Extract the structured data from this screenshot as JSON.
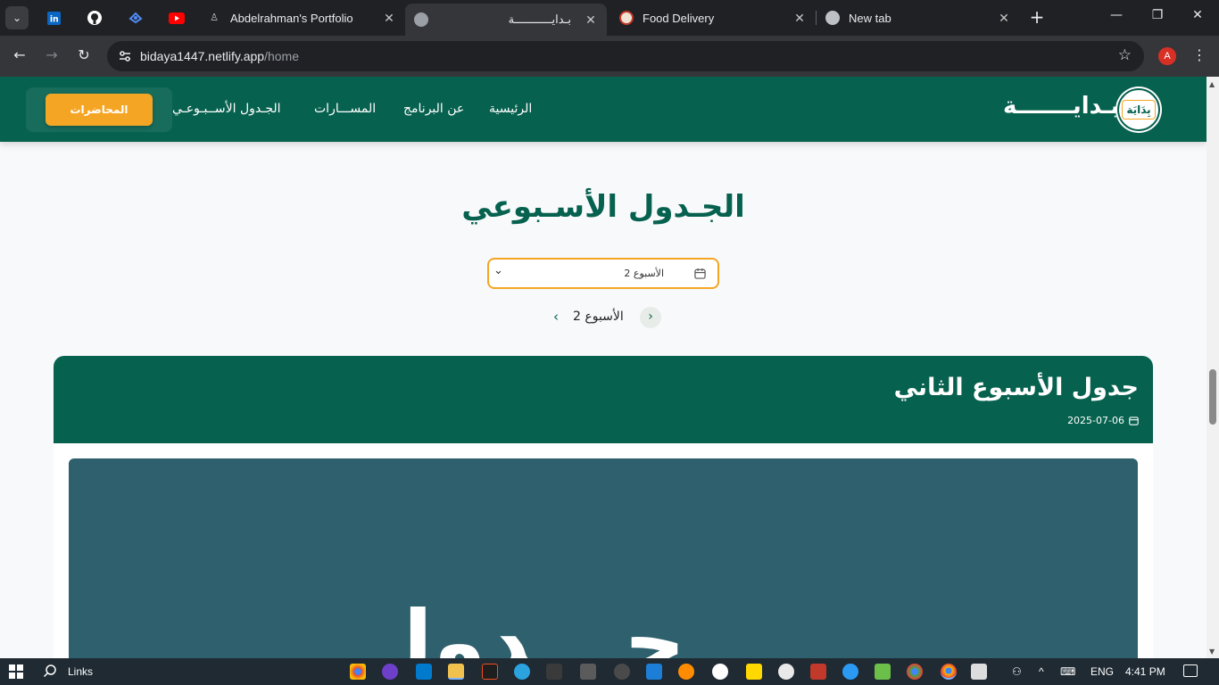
{
  "browser": {
    "tabs": [
      {
        "title": "Abdelrahman's Portfolio"
      },
      {
        "title": "بـدايـــــــــــة"
      },
      {
        "title": "Food Delivery"
      },
      {
        "title": "New tab"
      }
    ],
    "pinned_icons": [
      "linkedin-icon",
      "github-icon",
      "codepen-icon",
      "youtube-icon"
    ],
    "url_host": "bidaya1447.netlify.app",
    "url_path": "/home",
    "profile_initial": "A"
  },
  "header": {
    "brand": "بـدايـــــــة",
    "logo_text": "بِدَايَة",
    "cta_label": "المحاضرات",
    "nav": [
      "الرئيسية",
      "عن البرنامج",
      "المســـارات",
      "الجـدول الأســبـوعـي"
    ]
  },
  "main": {
    "title": "الجـدول الأسـبوعي",
    "week_select": {
      "value": "الأسبوع 2"
    },
    "week_nav_label": "الأسبوع 2",
    "card": {
      "title": "جدول الأسبوع الثاني",
      "date": "2025-07-06",
      "image_text": "جـــدول"
    }
  },
  "taskbar": {
    "links_label": "Links",
    "lang": "ENG",
    "time": "4:41 PM"
  },
  "colors": {
    "brand_green": "#07614f",
    "accent_orange": "#f5a524",
    "image_bg": "#2e606d"
  }
}
